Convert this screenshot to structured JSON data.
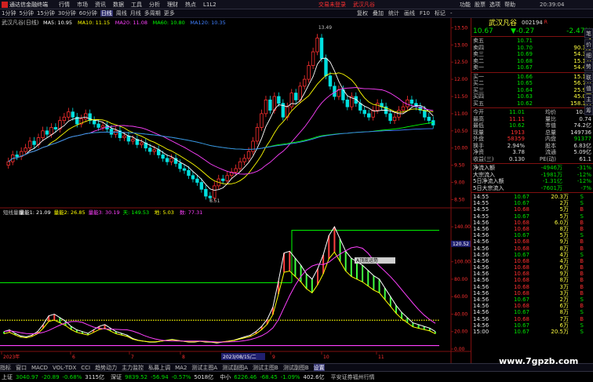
{
  "titlebar": {
    "app_name": "通达信金融终端",
    "menus": [
      "行情",
      "市场",
      "资讯",
      "数据",
      "工具",
      "分析",
      "理财",
      "热点",
      "L1L2"
    ],
    "notice": "交易未登录",
    "stock_name": "武汉凡谷",
    "right_menus": [
      "功能",
      "股票",
      "选项",
      "帮助"
    ]
  },
  "toolbar": {
    "periods": [
      "1分钟",
      "5分钟",
      "15分钟",
      "30分钟",
      "60分钟",
      "日线",
      "周线",
      "月线",
      "多周期",
      "更多"
    ],
    "active_period": "日线",
    "tools": [
      "复权",
      "叠加",
      "统计",
      "画线",
      "F10",
      "标记",
      "-"
    ]
  },
  "main_chart": {
    "title": "武汉凡谷(日线)",
    "ma_legend": [
      {
        "label": "MA5: 10.95",
        "color": "#ffffff"
      },
      {
        "label": "MA10: 11.15",
        "color": "#ffff00"
      },
      {
        "label": "MA20: 11.08",
        "color": "#ff40ff"
      },
      {
        "label": "MA60: 10.80",
        "color": "#00ff00"
      },
      {
        "label": "MA120: 10.35",
        "color": "#4080ff"
      }
    ],
    "high_label": "13.49",
    "low_label": "8.51",
    "prices": [
      "13.50",
      "13.00",
      "12.50",
      "12.00",
      "11.50",
      "11.00",
      "10.50",
      "10.00",
      "9.50",
      "9.00",
      "8.50"
    ]
  },
  "indicator": {
    "legend": [
      {
        "label": "短线量能",
        "color": "#c0c0c0"
      },
      {
        "label": "量能1: 21.09",
        "color": "#ffffff"
      },
      {
        "label": "量能2: 26.85",
        "color": "#ffff00"
      },
      {
        "label": "量能3: 30.19",
        "color": "#ff40ff"
      },
      {
        "label": "天: 149.53",
        "color": "#00ff00"
      },
      {
        "label": "地: 5.03",
        "color": "#ffff00"
      },
      {
        "label": "数: 77.31",
        "color": "#ff40ff"
      }
    ],
    "popup": "A顶底运势",
    "scale": [
      "140.00",
      "120.00",
      "100.00",
      "80.00",
      "60.00",
      "40.00",
      "20.00",
      "0.00"
    ],
    "current": "120.52"
  },
  "xaxis": {
    "labels": [
      "2023年",
      "6",
      "7",
      "8",
      "9",
      "10",
      "11"
    ],
    "date_box": "2023/08/15/二"
  },
  "quote": {
    "name": "武汉凡谷",
    "code": "002194",
    "flag": "R",
    "price": "10.67",
    "change": "▼-0.27",
    "pct": "-2.47%",
    "asks": [
      {
        "l": "卖五",
        "p": "10.71",
        "v": "4"
      },
      {
        "l": "卖四",
        "p": "10.70",
        "v": "90.3万"
      },
      {
        "l": "卖三",
        "p": "10.69",
        "v": "54.3万"
      },
      {
        "l": "卖二",
        "p": "10.68",
        "v": "15.1万"
      },
      {
        "l": "卖一",
        "p": "10.67",
        "v": "54.4万"
      }
    ],
    "bids": [
      {
        "l": "买一",
        "p": "10.66",
        "v": "15.1万"
      },
      {
        "l": "买二",
        "p": "10.65",
        "v": "56.7万"
      },
      {
        "l": "买三",
        "p": "10.64",
        "v": "25.9万"
      },
      {
        "l": "买四",
        "p": "10.63",
        "v": "45.0万"
      },
      {
        "l": "买五",
        "p": "10.62",
        "v": "158.3万"
      }
    ],
    "stats": [
      {
        "a": "今开",
        "b": "11.01",
        "c": "均价",
        "d": "10.76"
      },
      {
        "a": "最高",
        "b": "11.11",
        "c": "量比",
        "d": "0.74"
      },
      {
        "a": "最低",
        "b": "10.62",
        "c": "市值",
        "d": "74.2亿"
      },
      {
        "a": "现量",
        "b": "1913",
        "c": "总量",
        "d": "149736"
      },
      {
        "a": "外盘",
        "b": "58359",
        "c": "内盘",
        "d": "91377"
      },
      {
        "a": "换手",
        "b": "2.94%",
        "c": "股本",
        "d": "6.83亿"
      },
      {
        "a": "净资",
        "b": "3.78",
        "c": "流通",
        "d": "5.09亿"
      },
      {
        "a": "收益(三)",
        "b": "0.130",
        "c": "PE(动)",
        "d": "61.1"
      }
    ],
    "flows": [
      {
        "l": "净流入额",
        "v": "-4946万",
        "p": "-31%"
      },
      {
        "l": "大宗流入",
        "v": "-1981万",
        "p": "-12%"
      },
      {
        "l": "5日净流入额",
        "v": "-1.31亿",
        "p": "-12%"
      },
      {
        "l": "5日大宗流入",
        "v": "-7601万",
        "p": "-7%"
      }
    ],
    "ticks": [
      {
        "t": "14:55",
        "p": "10.67",
        "v": "20.3万",
        "s": "S"
      },
      {
        "t": "14:55",
        "p": "10.67",
        "v": "2万",
        "s": "S"
      },
      {
        "t": "14:55",
        "p": "10.68",
        "v": "5万",
        "s": "B"
      },
      {
        "t": "14:55",
        "p": "10.67",
        "v": "5万",
        "s": "S"
      },
      {
        "t": "14:56",
        "p": "10.68",
        "v": "6.0万",
        "s": "B"
      },
      {
        "t": "14:56",
        "p": "10.68",
        "v": "8万",
        "s": "B"
      },
      {
        "t": "14:56",
        "p": "10.67",
        "v": "5万",
        "s": "S"
      },
      {
        "t": "14:56",
        "p": "10.68",
        "v": "9万",
        "s": "B"
      },
      {
        "t": "14:56",
        "p": "10.68",
        "v": "8万",
        "s": "B"
      },
      {
        "t": "14:56",
        "p": "10.67",
        "v": "4万",
        "s": "S"
      },
      {
        "t": "14:56",
        "p": "10.68",
        "v": "4万",
        "s": "B"
      },
      {
        "t": "14:56",
        "p": "10.68",
        "v": "6万",
        "s": "B"
      },
      {
        "t": "14:56",
        "p": "10.68",
        "v": "9万",
        "s": "B"
      },
      {
        "t": "14:56",
        "p": "10.68",
        "v": "8万",
        "s": "B"
      },
      {
        "t": "14:56",
        "p": "10.68",
        "v": "3万",
        "s": "B"
      },
      {
        "t": "14:56",
        "p": "10.68",
        "v": "3万",
        "s": "B"
      },
      {
        "t": "14:56",
        "p": "10.67",
        "v": "2万",
        "s": "S"
      },
      {
        "t": "14:56",
        "p": "10.68",
        "v": "6万",
        "s": "B"
      },
      {
        "t": "14:56",
        "p": "10.67",
        "v": "8万",
        "s": "S"
      },
      {
        "t": "14:56",
        "p": "10.68",
        "v": "7万",
        "s": "B"
      },
      {
        "t": "14:56",
        "p": "10.67",
        "v": "6万",
        "s": "S"
      },
      {
        "t": "15:00",
        "p": "10.67",
        "v": "20.5万",
        "s": "S"
      }
    ],
    "side_tabs": [
      "笔",
      "价",
      "细",
      "势",
      "联",
      "值",
      "主",
      "筹"
    ]
  },
  "bottom_tabs": [
    "指标",
    "窗口",
    "MACD",
    "VOL-TDX",
    "CCI",
    "趋势动力",
    "主力监控",
    "私募上调",
    "MA2",
    "测试主图A",
    "测试副图A",
    "测试主图B",
    "测试副图B",
    "设置"
  ],
  "second_tabs": [
    "扩展",
    "关联报价",
    "资金分布",
    "综合资讯",
    "行业资讯",
    "百战资讯",
    "普及版本配说明"
  ],
  "status": {
    "sh_label": "上证",
    "sh_val": "3040.97",
    "sh_chg": "-20.89",
    "sh_pct": "-0.68%",
    "sh_amt": "3115亿",
    "sz_label": "深证",
    "sz_val": "9839.52",
    "sz_chg": "-56.94",
    "sz_pct": "-0.57%",
    "sz_amt": "5018亿",
    "zx_label": "中小",
    "zx_val": "6226.46",
    "zx_chg": "-68.45",
    "zx_pct": "-1.09%",
    "zx_amt": "402.6亿",
    "broker": "平安证券福州行情"
  },
  "watermark": "www.7gpzb.com"
}
